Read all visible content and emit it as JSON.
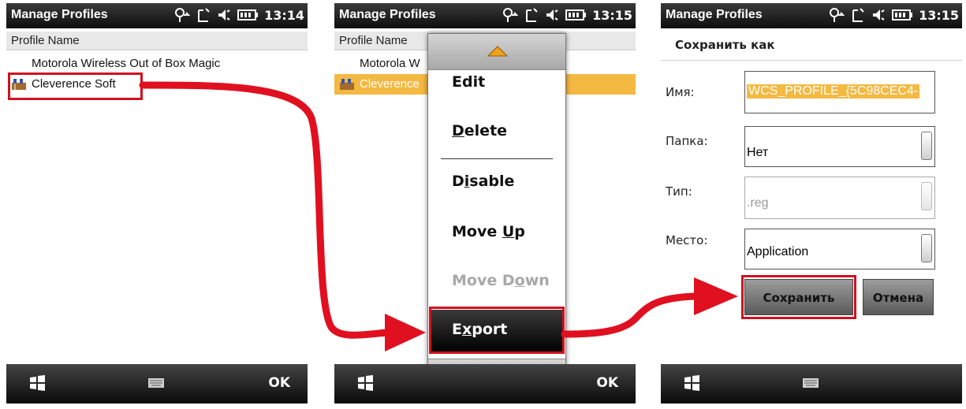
{
  "screens": {
    "left": {
      "title": "Manage Profiles",
      "time": "13:14",
      "column_header": "Profile Name",
      "profiles": [
        {
          "name": "Motorola Wireless Out of Box Magic"
        },
        {
          "name": "Cleverence Soft"
        }
      ],
      "ok_label": "OK"
    },
    "middle": {
      "title": "Manage Profiles",
      "time": "13:15",
      "column_header": "Profile Name",
      "profiles": [
        {
          "name": "Motorola W"
        },
        {
          "name": "Cleverence"
        }
      ],
      "menu": {
        "items": [
          {
            "label": "Edit",
            "underline": "",
            "enabled": true
          },
          {
            "label": "Delete",
            "underline": "D",
            "enabled": true
          },
          {
            "label": "Disable",
            "underline": "i",
            "enabled": true
          },
          {
            "label": "Move Up",
            "underline": "U",
            "enabled": true
          },
          {
            "label": "Move Down",
            "underline": "o",
            "enabled": false
          },
          {
            "label": "Export",
            "underline": "x",
            "enabled": true
          }
        ]
      },
      "ok_label": "OK"
    },
    "right": {
      "title": "Manage Profiles",
      "time": "13:15",
      "dialog_title": "Сохранить как",
      "fields": {
        "name_label": "Имя:",
        "name_value": "WCS_PROFILE_{5C98CEC4-",
        "folder_label": "Папка:",
        "folder_value": "Нет",
        "type_label": "Тип:",
        "type_value": ".reg",
        "location_label": "Место:",
        "location_value": "Application"
      },
      "save_label": "Сохранить",
      "cancel_label": "Отмена"
    }
  },
  "colors": {
    "highlight_red": "#d01020",
    "selection_orange": "#f4b942",
    "bar_dark": "#111111"
  },
  "icons": [
    "start-icon",
    "keyboard-icon",
    "antenna-icon",
    "speaker-icon",
    "battery-icon",
    "profile-icon",
    "up-arrow-icon",
    "down-arrow-icon",
    "dropdown-icon"
  ]
}
